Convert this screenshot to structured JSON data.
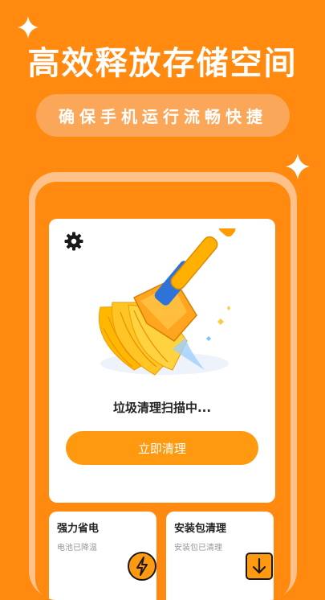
{
  "colors": {
    "background": "#FF8A0F",
    "accent": "#FF9910",
    "pill": "#FBA759"
  },
  "promo": {
    "headline": "高效释放存储空间",
    "subtitle": "确保手机运行流畅快捷"
  },
  "app": {
    "settings_icon": "gear-icon",
    "status_text": "垃圾清理扫描中...",
    "clean_button": "立即清理",
    "cards": [
      {
        "title": "强力省电",
        "subtitle": "电池已降温",
        "icon": "lightning-icon"
      },
      {
        "title": "安装包清理",
        "subtitle": "安装包已清理",
        "icon": "download-icon"
      }
    ]
  }
}
